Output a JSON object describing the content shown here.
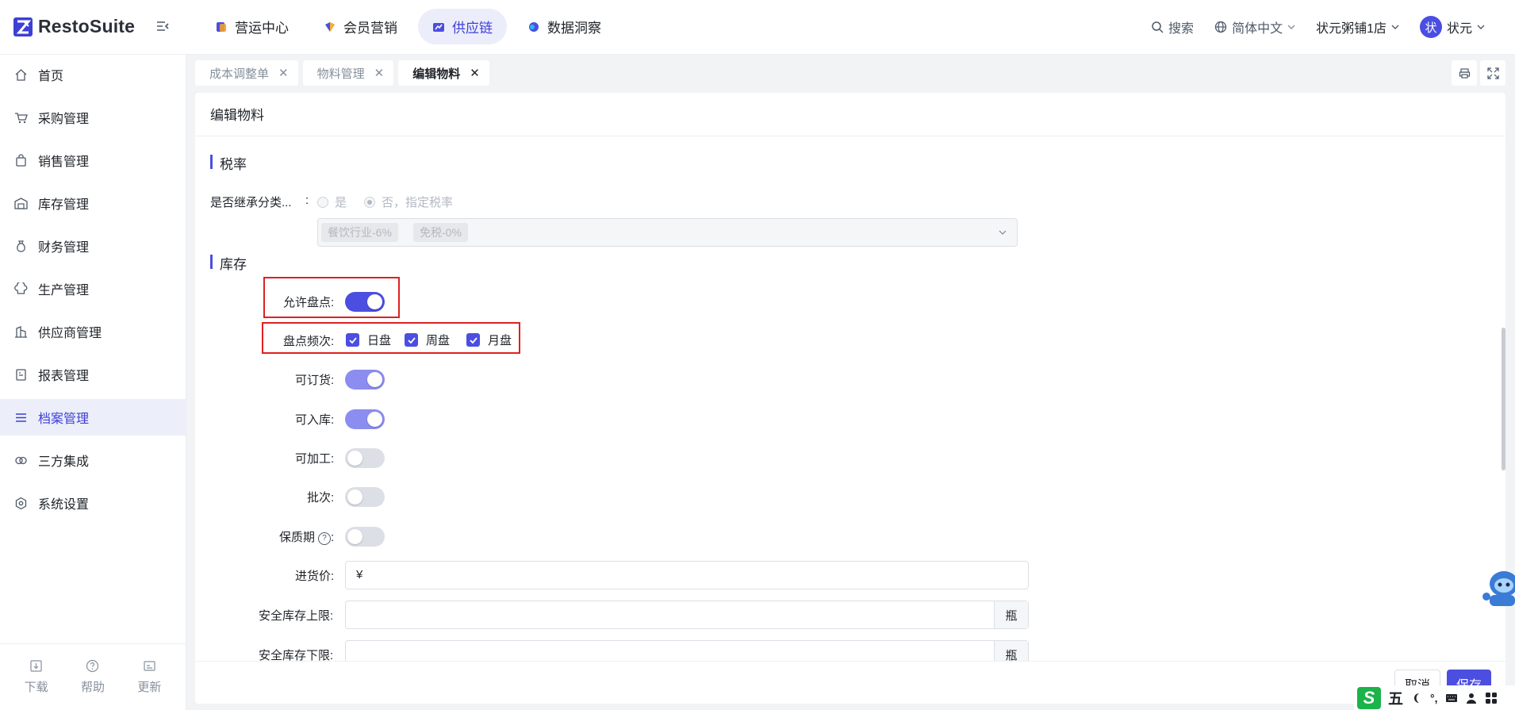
{
  "app": {
    "brand": "RestoSuite"
  },
  "top_nav": [
    {
      "label": "营运中心",
      "icon": "ops-center-icon",
      "active": false
    },
    {
      "label": "会员营销",
      "icon": "member-marketing-icon",
      "active": false
    },
    {
      "label": "供应链",
      "icon": "supply-chain-icon",
      "active": true
    },
    {
      "label": "数据洞察",
      "icon": "data-insight-icon",
      "active": false
    }
  ],
  "top_right": {
    "search": "搜索",
    "language": "简体中文",
    "store": "状元粥铺1店",
    "avatar_char": "状",
    "user": "状元"
  },
  "sidebar": {
    "items": [
      {
        "label": "首页",
        "icon": "home-icon"
      },
      {
        "label": "采购管理",
        "icon": "cart-icon"
      },
      {
        "label": "销售管理",
        "icon": "bag-icon"
      },
      {
        "label": "库存管理",
        "icon": "warehouse-icon"
      },
      {
        "label": "财务管理",
        "icon": "money-bag-icon"
      },
      {
        "label": "生产管理",
        "icon": "chef-hat-icon"
      },
      {
        "label": "供应商管理",
        "icon": "building-icon"
      },
      {
        "label": "报表管理",
        "icon": "report-icon"
      },
      {
        "label": "档案管理",
        "icon": "list-icon",
        "active": true
      },
      {
        "label": "三方集成",
        "icon": "integration-icon"
      },
      {
        "label": "系统设置",
        "icon": "settings-icon"
      }
    ],
    "bottom": {
      "download": "下载",
      "help": "帮助",
      "update": "更新"
    }
  },
  "page_tabs": [
    {
      "label": "成本调整单",
      "active": false
    },
    {
      "label": "物料管理",
      "active": false
    },
    {
      "label": "编辑物料",
      "active": true
    }
  ],
  "form": {
    "title": "编辑物料",
    "tax_section": "税率",
    "inherit_label": "是否继承分类...",
    "inherit_colon": ":",
    "radio_yes": "是",
    "radio_no": "否，指定税率",
    "tax_tags": [
      "餐饮行业-6%",
      "免税-0%"
    ],
    "stock_section": "库存",
    "allow_count_label": "允许盘点:",
    "allow_count": true,
    "count_freq_label": "盘点频次:",
    "freq_options": [
      "日盘",
      "周盘",
      "月盘"
    ],
    "orderable_label": "可订货:",
    "orderable": true,
    "receivable_label": "可入库:",
    "receivable": true,
    "processable_label": "可加工:",
    "processable": false,
    "batch_label": "批次:",
    "batch": false,
    "shelf_life_label": "保质期",
    "shelf_life_colon": ":",
    "shelf_life": false,
    "purchase_price_label": "进货价:",
    "currency": "¥",
    "purchase_price": "",
    "safety_upper_label": "安全库存上限:",
    "safety_upper": "",
    "safety_lower_label": "安全库存下限:",
    "safety_lower": "",
    "unit": "瓶",
    "cancel": "取消",
    "save": "保存"
  },
  "ime": {
    "mode": "五",
    "punct": "°,"
  },
  "colors": {
    "accent": "#4b4ee0",
    "highlight_box": "#e02020",
    "active_bg": "#eceef9"
  }
}
